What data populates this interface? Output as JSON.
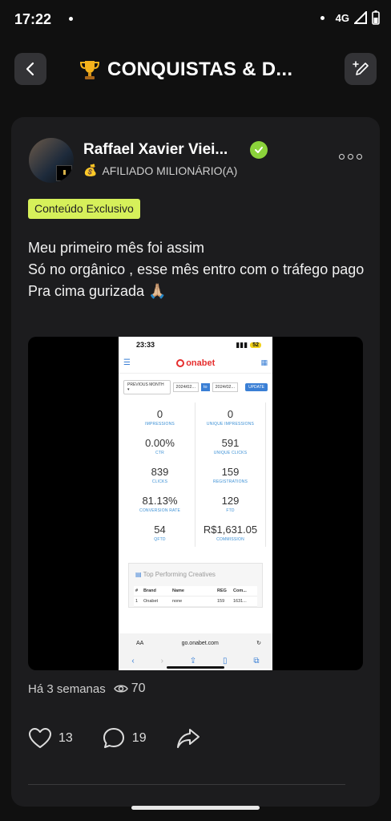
{
  "status_bar": {
    "time": "17:22",
    "network": "4G"
  },
  "header": {
    "title": "CONQUISTAS & D...",
    "title_icon": "trophy-icon"
  },
  "post": {
    "author": "Raffael Xavier Viei...",
    "role_emoji": "💰",
    "role": "AFILIADO MILIONÁRIO(A)",
    "tag": "Conteúdo Exclusivo",
    "text_lines": [
      "Meu primeiro mês foi assim",
      "Só no orgânico , esse mês entro com o tráfego pago",
      "Pra cima gurizada 🙏🏼"
    ],
    "time_ago": "Há 3 semanas",
    "views": "70",
    "likes": "13",
    "comments": "19"
  },
  "screenshot": {
    "time": "23:33",
    "battery": "52",
    "logo": "onabet",
    "filter": {
      "period": "PREVIOUS MONTH",
      "date_from": "2024/02...",
      "to": "to",
      "date_to": "2024/02...",
      "update": "UPDATE"
    },
    "stats": [
      {
        "value": "0",
        "label": "IMPRESSIONS"
      },
      {
        "value": "0",
        "label": "UNIQUE IMPRESSIONS"
      },
      {
        "value": "0.00%",
        "label": "CTR"
      },
      {
        "value": "591",
        "label": "UNIQUE CLICKS"
      },
      {
        "value": "839",
        "label": "CLICKS"
      },
      {
        "value": "159",
        "label": "REGISTRATIONS"
      },
      {
        "value": "81.13%",
        "label": "CONVERSION RATE"
      },
      {
        "value": "129",
        "label": "FTD"
      },
      {
        "value": "54",
        "label": "QFTD"
      },
      {
        "value": "R$1,631.05",
        "label": "COMMISSION"
      }
    ],
    "top_title": "Top Performing Creatives",
    "table_headers": [
      "#",
      "Brand",
      "Name",
      "REG",
      "Com..."
    ],
    "table_rows": [
      [
        "1",
        "Onabet",
        "none",
        "159",
        "1631..."
      ]
    ],
    "url_prefix": "AA",
    "url": "go.onabet.com"
  }
}
